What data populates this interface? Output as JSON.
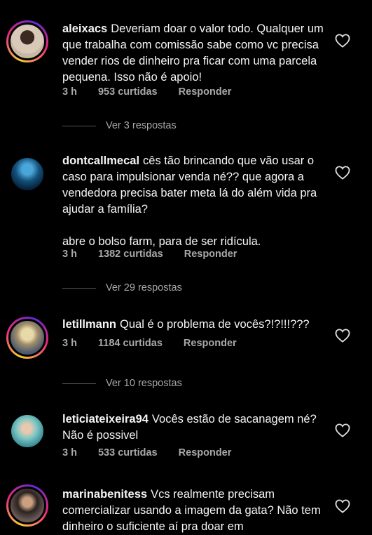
{
  "comments": [
    {
      "username": "aleixacs",
      "text": "Deveriam doar o valor todo. Qualquer um que trabalha com comissão sabe como vc precisa vender rios de dinheiro pra ficar com uma parcela pequena. Isso não é apoio!",
      "time": "3 h",
      "likes": "953 curtidas",
      "reply": "Responder",
      "view_replies": "Ver 3 respostas"
    },
    {
      "username": "dontcallmecal",
      "text": "cês tão brincando que vão usar o caso para impulsionar venda né?? que agora a vendedora precisa bater meta lá do além vida pra ajudar a família?\n\nabre o bolso farm, para de ser ridícula.",
      "time": "3 h",
      "likes": "1382 curtidas",
      "reply": "Responder",
      "view_replies": "Ver 29 respostas"
    },
    {
      "username": "letillmann",
      "text": "Qual é o problema de vocês?!?!!!???",
      "time": "3 h",
      "likes": "1184 curtidas",
      "reply": "Responder",
      "view_replies": "Ver 10 respostas"
    },
    {
      "username": "leticiateixeira94",
      "text": "Vocês estão de sacanagem né? Não é possivel",
      "time": "3 h",
      "likes": "533 curtidas",
      "reply": "Responder"
    },
    {
      "username": "marinabenitess",
      "text": "Vcs realmente precisam comercializar usando a imagem da gata? Não tem dinheiro o suficiente aí pra doar em"
    }
  ],
  "icons": {
    "like": "heart-outline-icon"
  },
  "colors": {
    "background": "#000000",
    "secondary_text": "#a8a8a8",
    "story_ring": "#ee2a7b"
  }
}
